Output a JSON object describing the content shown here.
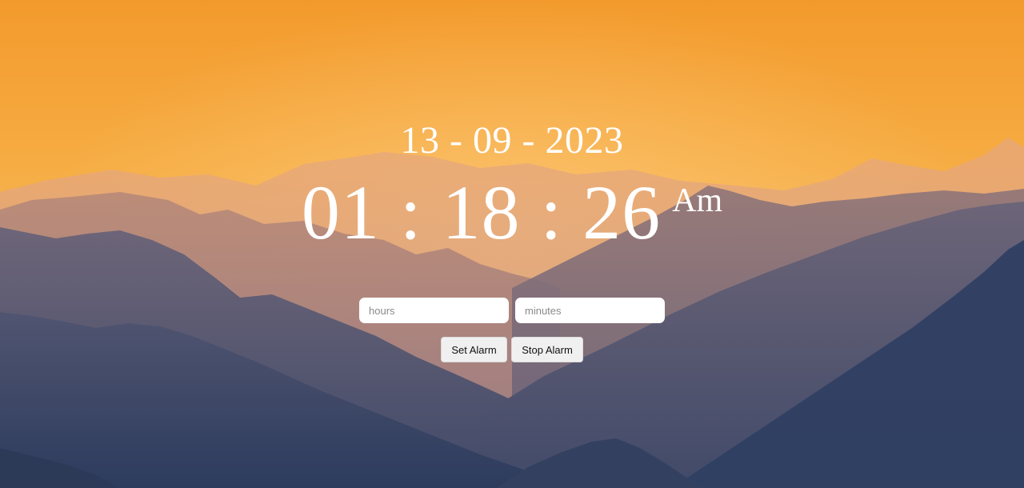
{
  "clock": {
    "date": "13 - 09 - 2023",
    "time": "01 : 18 : 26",
    "period": "Am"
  },
  "alarm": {
    "hours_placeholder": "hours",
    "hours_value": "",
    "minutes_placeholder": "minutes",
    "minutes_value": "",
    "set_label": "Set Alarm",
    "stop_label": "Stop Alarm"
  },
  "background": {
    "description_icon": "mountain-sunset-icon",
    "sky_top_color": "#f4a13a",
    "sky_bottom_color": "#f2b85a",
    "mountain_far_color": "#b88a7f",
    "mountain_mid_color": "#7e6a7c",
    "mountain_near_color": "#3c4869"
  }
}
